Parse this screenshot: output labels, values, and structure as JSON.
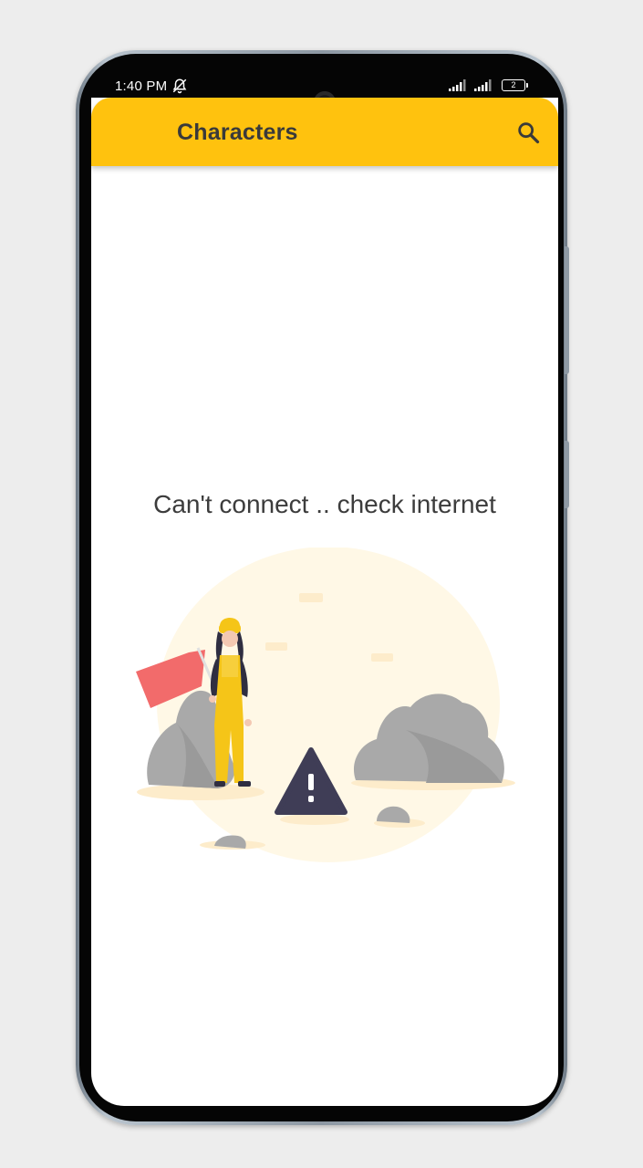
{
  "status_bar": {
    "time": "1:40 PM",
    "notification_icon": "bell-off-icon",
    "signal_icons": [
      "signal-icon",
      "signal-icon"
    ],
    "battery_level": "2"
  },
  "app_bar": {
    "title": "Characters",
    "search_icon": "search-icon",
    "color": "#ffc20e"
  },
  "content": {
    "error_message": "Can't connect .. check internet",
    "illustration": "no-connection-illustration"
  },
  "colors": {
    "accent": "#ffc20e",
    "warning": "#3f3d56",
    "flag": "#f26b6b"
  }
}
